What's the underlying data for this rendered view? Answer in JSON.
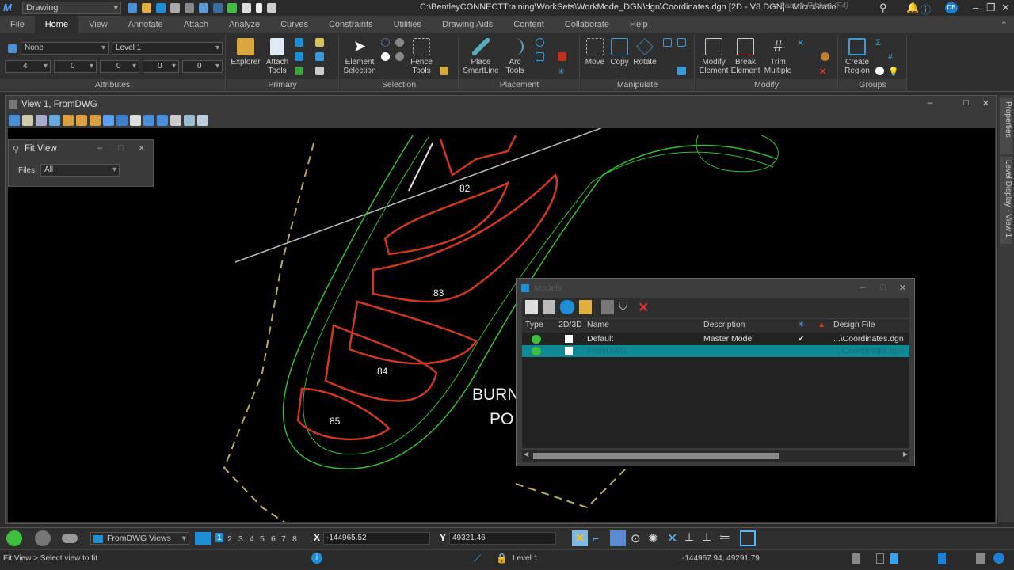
{
  "app": {
    "workspace": "Drawing",
    "title": "C:\\BentleyCONNECTTraining\\WorkSets\\WorkMode_DGN\\dgn\\Coordinates.dgn [2D - V8 DGN] - MicroStatio",
    "search_placeholder": "Search Ribbon (F4)",
    "user_initials": "DB"
  },
  "menu_tabs": [
    "File",
    "Home",
    "View",
    "Annotate",
    "Attach",
    "Analyze",
    "Curves",
    "Constraints",
    "Utilities",
    "Drawing Aids",
    "Content",
    "Collaborate",
    "Help"
  ],
  "ribbon": {
    "attributes": {
      "label": "Attributes",
      "element_template": "None",
      "level": "Level 1",
      "color": "4",
      "weight": "0",
      "style": "0",
      "transparency": "0",
      "priority": "0"
    },
    "primary": {
      "label": "Primary",
      "explorer": "Explorer",
      "attach_tools": "Attach Tools"
    },
    "selection": {
      "label": "Selection",
      "element_selection": "Element Selection",
      "fence_tools": "Fence Tools"
    },
    "placement": {
      "label": "Placement",
      "place_smartline": "Place SmartLine",
      "arc_tools": "Arc Tools"
    },
    "manipulate": {
      "label": "Manipulate",
      "move": "Move",
      "copy": "Copy",
      "rotate": "Rotate"
    },
    "modify": {
      "label": "Modify",
      "modify_element": "Modify Element",
      "break_element": "Break Element",
      "trim_multiple": "Trim Multiple"
    },
    "groups": {
      "label": "Groups",
      "create_region": "Create Region"
    }
  },
  "view": {
    "title": "View 1, FromDWG",
    "labels": [
      "82",
      "83",
      "84",
      "85"
    ],
    "text1": "BURN",
    "text2": "PO"
  },
  "fit_view": {
    "title": "Fit View",
    "files_label": "Files:",
    "files_value": "All"
  },
  "models": {
    "title": "Models",
    "columns": [
      "Type",
      "2D/3D",
      "Name",
      "Description",
      "",
      "",
      "Design File"
    ],
    "rows": [
      {
        "name": "Default",
        "description": "Master Model",
        "checked": "✔",
        "design_file": "...\\Coordinates.dgn",
        "selected": false
      },
      {
        "name": "FromDWG",
        "description": "",
        "checked": "",
        "design_file": "...\\Coordinates.dgn",
        "selected": true
      }
    ]
  },
  "right_dock": {
    "properties": "Properties",
    "level_display": "Level Display - View 1"
  },
  "bottom": {
    "views_combo": "FromDWG Views",
    "view_numbers": [
      "1",
      "2",
      "3",
      "4",
      "5",
      "6",
      "7",
      "8"
    ],
    "x_label": "X",
    "x_value": "-144965.52",
    "y_label": "Y",
    "y_value": "49321.46"
  },
  "status": {
    "prompt": "Fit View > Select view to fit",
    "level": "Level 1",
    "coordinates": "-144967.94, 49291.79"
  },
  "colors": {
    "accent": "#1e8fd6",
    "selection": "#0e8a96",
    "green": "#2fbf2f",
    "red": "#d0381e"
  }
}
